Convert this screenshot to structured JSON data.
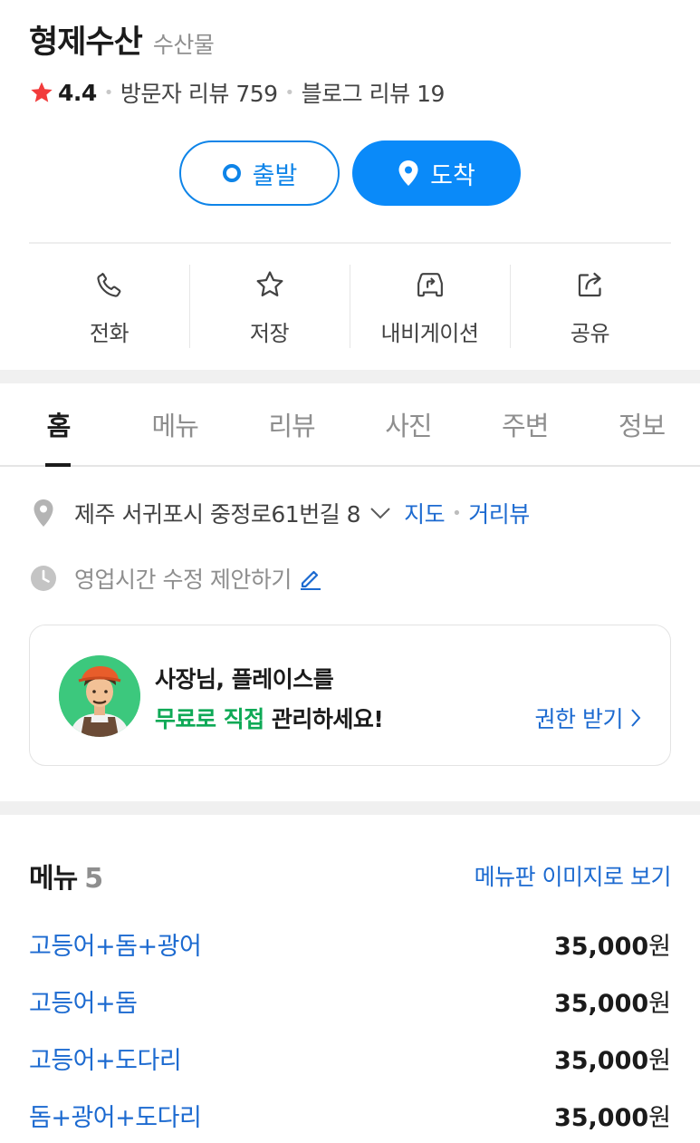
{
  "place": {
    "name": "형제수산",
    "category": "수산물",
    "rating": "4.4",
    "visitor_reviews": "방문자 리뷰 759",
    "blog_reviews": "블로그 리뷰 19"
  },
  "route": {
    "depart_label": "출발",
    "arrive_label": "도착"
  },
  "actions": [
    {
      "label": "전화",
      "icon": "phone-icon"
    },
    {
      "label": "저장",
      "icon": "star-outline-icon"
    },
    {
      "label": "내비게이션",
      "icon": "car-navigation-icon"
    },
    {
      "label": "공유",
      "icon": "share-icon"
    }
  ],
  "tabs": [
    {
      "label": "홈",
      "active": true
    },
    {
      "label": "메뉴"
    },
    {
      "label": "리뷰"
    },
    {
      "label": "사진"
    },
    {
      "label": "주변"
    },
    {
      "label": "정보"
    }
  ],
  "info": {
    "address": "제주 서귀포시 중정로61번길 8",
    "map_link": "지도",
    "street_view_link": "거리뷰",
    "hours_suggest": "영업시간 수정 제안하기"
  },
  "owner_banner": {
    "line1": "사장님, 플레이스를",
    "line2_highlight": "무료로 직접",
    "line2_rest": " 관리하세요!",
    "claim_link": "권한 받기"
  },
  "menu": {
    "title": "메뉴",
    "count": "5",
    "image_link": "메뉴판 이미지로 보기",
    "items": [
      {
        "name": "고등어+돔+광어",
        "price": "35,000",
        "unit": "원"
      },
      {
        "name": "고등어+돔",
        "price": "35,000",
        "unit": "원"
      },
      {
        "name": "고등어+도다리",
        "price": "35,000",
        "unit": "원"
      },
      {
        "name": "돔+광어+도다리",
        "price": "35,000",
        "unit": "원"
      }
    ]
  },
  "colors": {
    "accent_blue": "#0a8af9",
    "link_blue": "#1c6ad0",
    "star_red": "#f23b3b",
    "owner_green": "#0ea956"
  }
}
